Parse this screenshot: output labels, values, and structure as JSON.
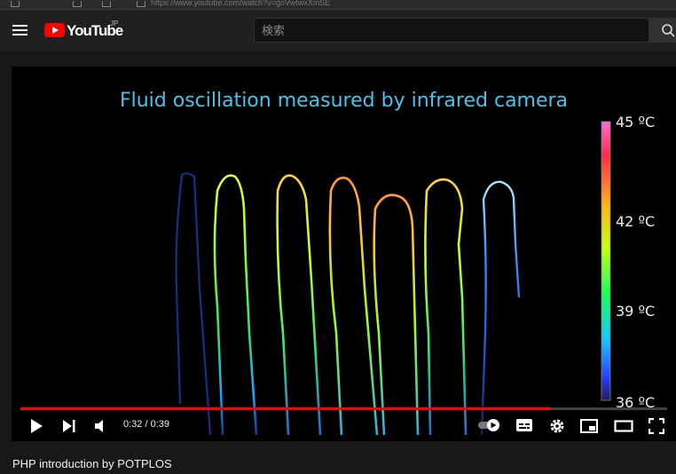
{
  "browser": {
    "url": "https://www.youtube.com/watch?v=goVwIwxXmSE"
  },
  "header": {
    "logo_text": "YouTube",
    "logo_region": "JP",
    "search": {
      "placeholder": "検索",
      "value": ""
    }
  },
  "video": {
    "overlay_title": "Fluid oscillation measured by infrared camera",
    "scale_labels": [
      "45 ºC",
      "42 ºC",
      "39 ºC",
      "36 ºC"
    ],
    "progress": 0.8205,
    "current_time": "0:32",
    "duration": "0:39",
    "time_display": "0:32 / 0:39",
    "autoplay_on": true
  },
  "caption": {
    "text": "PHP introduction by POTPLOS"
  },
  "colors": {
    "accent": "#ff0000",
    "title": "#45c4ee",
    "background": "#181818"
  },
  "icons": [
    "menu-icon",
    "search-icon",
    "play-icon",
    "next-icon",
    "volume-icon",
    "autoplay-toggle",
    "subtitles-icon",
    "settings-icon",
    "miniplayer-icon",
    "theater-icon",
    "fullscreen-icon"
  ]
}
